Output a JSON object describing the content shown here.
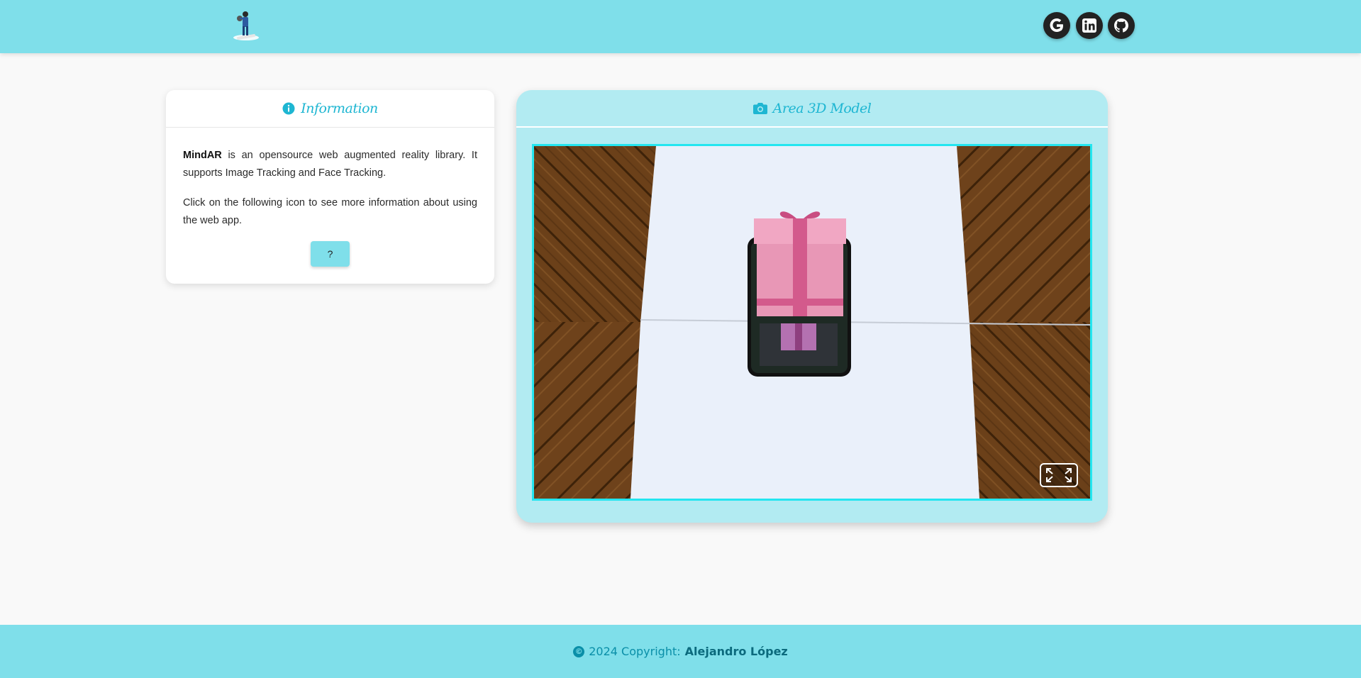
{
  "header": {
    "logo_icon": "ar-person-logo-icon",
    "social": [
      {
        "name": "google",
        "icon": "google-icon"
      },
      {
        "name": "linkedin",
        "icon": "linkedin-icon"
      },
      {
        "name": "github",
        "icon": "github-icon"
      }
    ]
  },
  "info": {
    "title": "Information",
    "icon": "info-circle-icon",
    "brand": "MindAR",
    "para1_rest": " is an opensource web augmented reality library. It supports Image Tracking and Face Tracking.",
    "para2": "Click on the following icon to see more information about using the web app.",
    "help_label": "?"
  },
  "model": {
    "title": "Area 3D Model",
    "icon": "camera-icon",
    "fullscreen_icon": "fullscreen-icon"
  },
  "footer": {
    "copyright_text": "2024 Copyright:",
    "author": "Alejandro López",
    "icon": "copyright-icon"
  },
  "colors": {
    "accent": "#7fdfea",
    "title": "#1eb6d2",
    "model_bg": "#b2ebf2",
    "viewer_border": "#24e6f0"
  }
}
